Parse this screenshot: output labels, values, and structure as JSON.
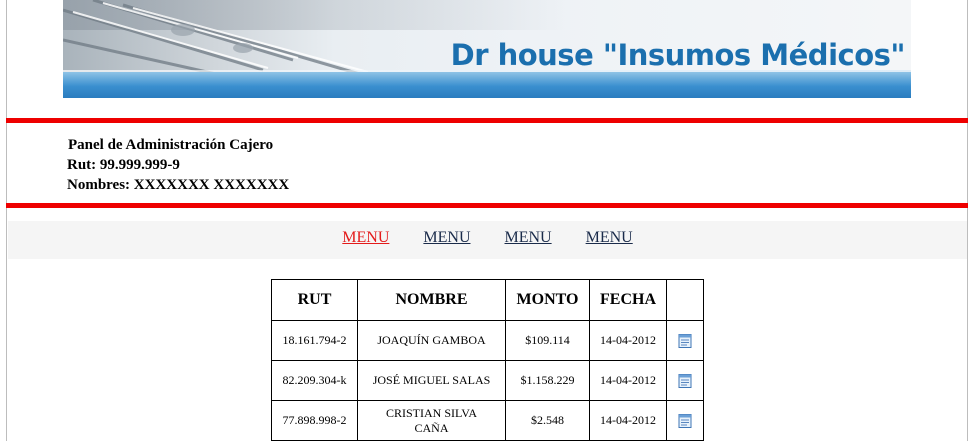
{
  "header": {
    "banner_title": "Dr house \"Insumos Médicos\""
  },
  "admin": {
    "panel_title": "Panel de Administración Cajero",
    "rut_line": "Rut: 99.999.999-9",
    "names_line": "Nombres: XXXXXXX XXXXXXX"
  },
  "menu": {
    "items": [
      {
        "label": "MENU",
        "active": true
      },
      {
        "label": "MENU",
        "active": false
      },
      {
        "label": "MENU",
        "active": false
      },
      {
        "label": "MENU",
        "active": false
      }
    ],
    "active_color": "#e41b1b",
    "link_color": "#1a2b4a"
  },
  "table": {
    "columns": [
      "RUT",
      "NOMBRE",
      "MONTO",
      "FECHA",
      ""
    ],
    "rows": [
      {
        "rut": "18.161.794-2",
        "nombre": "JOAQUÍN GAMBOA",
        "monto": "$109.114",
        "fecha": "14-04-2012",
        "icon": "document-icon"
      },
      {
        "rut": "82.209.304-k",
        "nombre": "JOSÉ MIGUEL SALAS",
        "monto": "$1.158.229",
        "fecha": "14-04-2012",
        "icon": "document-icon"
      },
      {
        "rut": "77.898.998-2",
        "nombre": "CRISTIAN SILVA CAÑA",
        "monto": "$2.548",
        "fecha": "14-04-2012",
        "icon": "document-icon"
      }
    ]
  },
  "colors": {
    "accent_red": "#ee0000",
    "banner_blue": "#1b6fae"
  }
}
